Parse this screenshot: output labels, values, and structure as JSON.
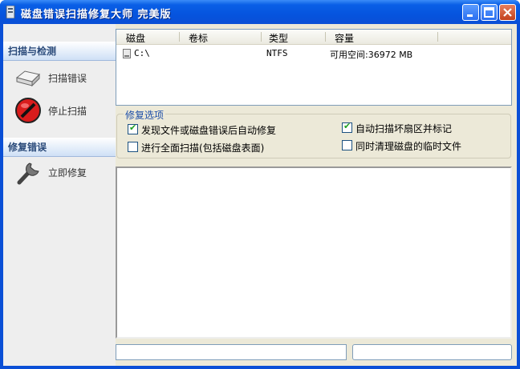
{
  "window": {
    "title": "磁盘错误扫描修复大师  完美版"
  },
  "sidebar": {
    "section1": "扫描与检测",
    "scan_label": "扫描错误",
    "stop_label": "停止扫描",
    "section2": "修复错误",
    "repair_label": "立即修复"
  },
  "disk_list": {
    "headers": [
      "磁盘",
      "卷标",
      "类型",
      "容量"
    ],
    "rows": [
      {
        "disk": "C:\\",
        "label": "",
        "type": "NTFS",
        "capacity": "可用空间:36972 MB"
      }
    ]
  },
  "options": {
    "legend": "修复选项",
    "auto_fix": {
      "label": "发现文件或磁盘错误后自动修复",
      "checked": true
    },
    "full_scan": {
      "label": "进行全面扫描(包括磁盘表面)",
      "checked": false
    },
    "bad_sector": {
      "label": "自动扫描坏扇区并标记",
      "checked": true
    },
    "clean_temp": {
      "label": "同时清理磁盘的临时文件",
      "checked": false
    }
  },
  "status": {
    "left": "",
    "right": ""
  },
  "colors": {
    "titlebar": "#0a5fe6",
    "accent": "#1d4ea8",
    "check": "#21a121"
  }
}
